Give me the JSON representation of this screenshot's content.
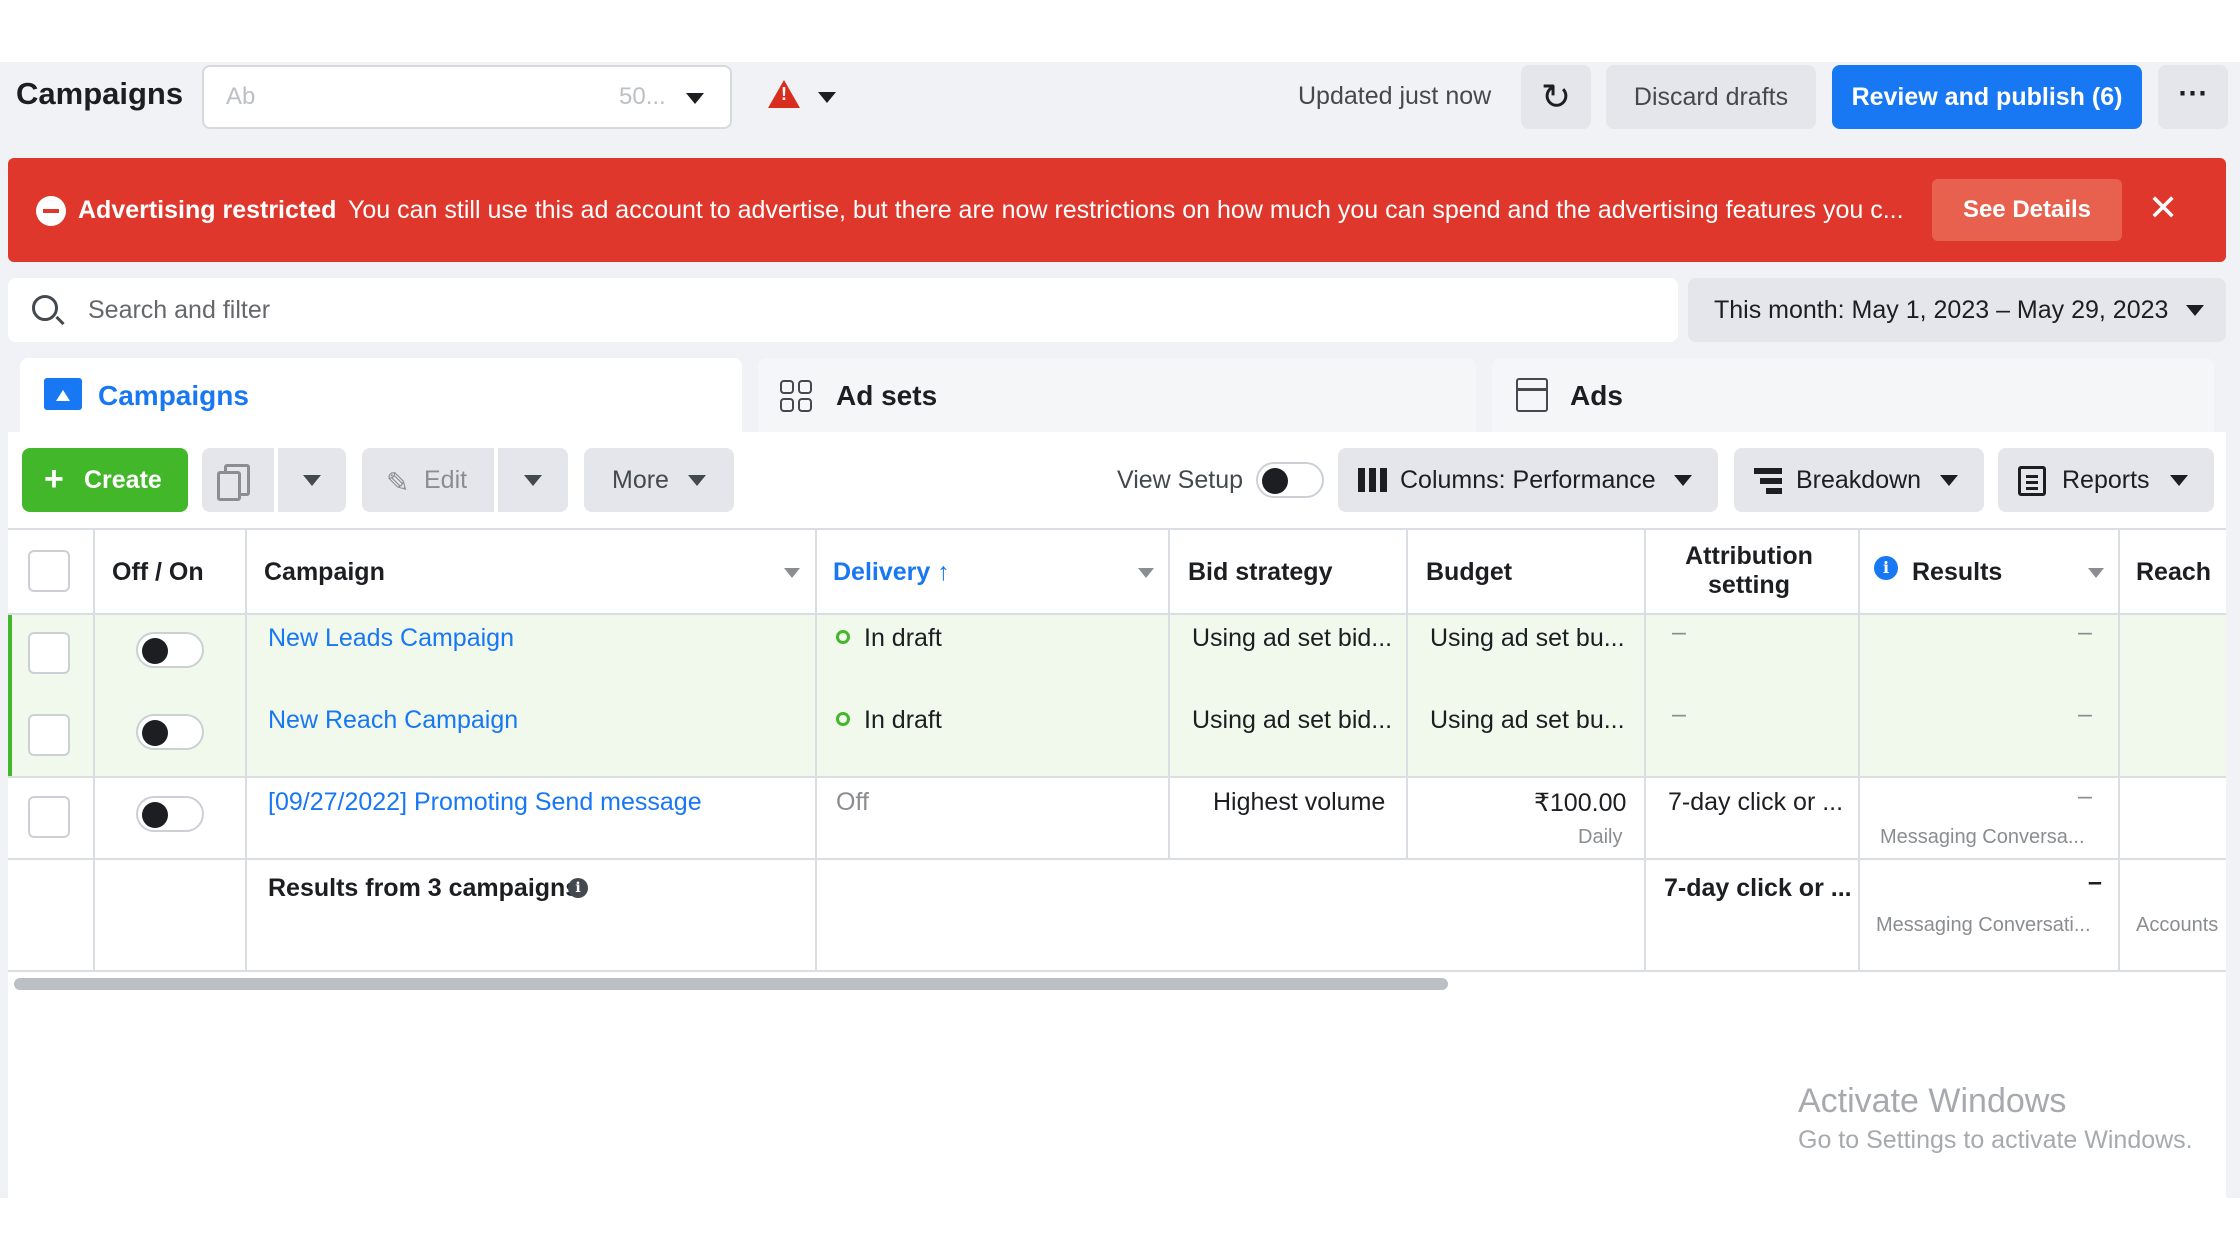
{
  "header": {
    "title": "Campaigns",
    "account_text_start": "Ab",
    "account_text_end": "50...",
    "updated_text": "Updated just now",
    "discard_label": "Discard drafts",
    "publish_label": "Review and publish (6)",
    "more_icon_text": "⋯"
  },
  "banner": {
    "title": "Advertising restricted",
    "message": "You can still use this ad account to advertise, but there are now restrictions on how much you can spend and the advertising features you c...",
    "details_label": "See Details",
    "close_text": "✕",
    "color": "#e0372c"
  },
  "search": {
    "placeholder": "Search and filter",
    "date_range": "This month: May 1, 2023 – May 29, 2023"
  },
  "tabs": [
    {
      "label": "Campaigns",
      "icon": "campaigns-icon",
      "active": true
    },
    {
      "label": "Ad sets",
      "icon": "grid-icon",
      "active": false
    },
    {
      "label": "Ads",
      "icon": "ads-icon",
      "active": false
    }
  ],
  "toolbar": {
    "create_label": "Create",
    "create_plus": "+",
    "edit_label": "Edit",
    "more_label": "More",
    "view_setup_label": "View Setup",
    "columns_label": "Columns: Performance",
    "breakdown_label": "Breakdown",
    "reports_label": "Reports"
  },
  "table": {
    "headers": {
      "offon": "Off / On",
      "campaign": "Campaign",
      "delivery": "Delivery ↑",
      "bid": "Bid strategy",
      "budget": "Budget",
      "attribution": "Attribution setting",
      "results": "Results",
      "reach": "Reach"
    },
    "rows": [
      {
        "name": "New Leads Campaign",
        "delivery": "In draft",
        "bid": "Using ad set bid...",
        "budget": "Using ad set bu...",
        "attribution": "–",
        "results": "–",
        "results_sub": ""
      },
      {
        "name": "New Reach Campaign",
        "delivery": "In draft",
        "bid": "Using ad set bid...",
        "budget": "Using ad set bu...",
        "attribution": "–",
        "results": "–",
        "results_sub": ""
      },
      {
        "name": "[09/27/2022] Promoting Send message",
        "delivery": "Off",
        "bid": "Highest volume",
        "budget": "₹100.00",
        "budget_sub": "Daily",
        "attribution": "7-day click or ...",
        "results": "–",
        "results_sub": "Messaging Conversa..."
      }
    ],
    "summary": {
      "label": "Results from 3 campaigns",
      "attribution": "7-day click or ...",
      "results": "–",
      "results_sub": "Messaging Conversati...",
      "reach_sub": "Accounts"
    }
  },
  "watermark": {
    "line1": "Activate Windows",
    "line2": "Go to Settings to activate Windows."
  },
  "colors": {
    "primary": "#1877f2",
    "create_green": "#42b72a",
    "banner_red": "#e0372c",
    "draft_row_bg": "#f1f8ec"
  }
}
